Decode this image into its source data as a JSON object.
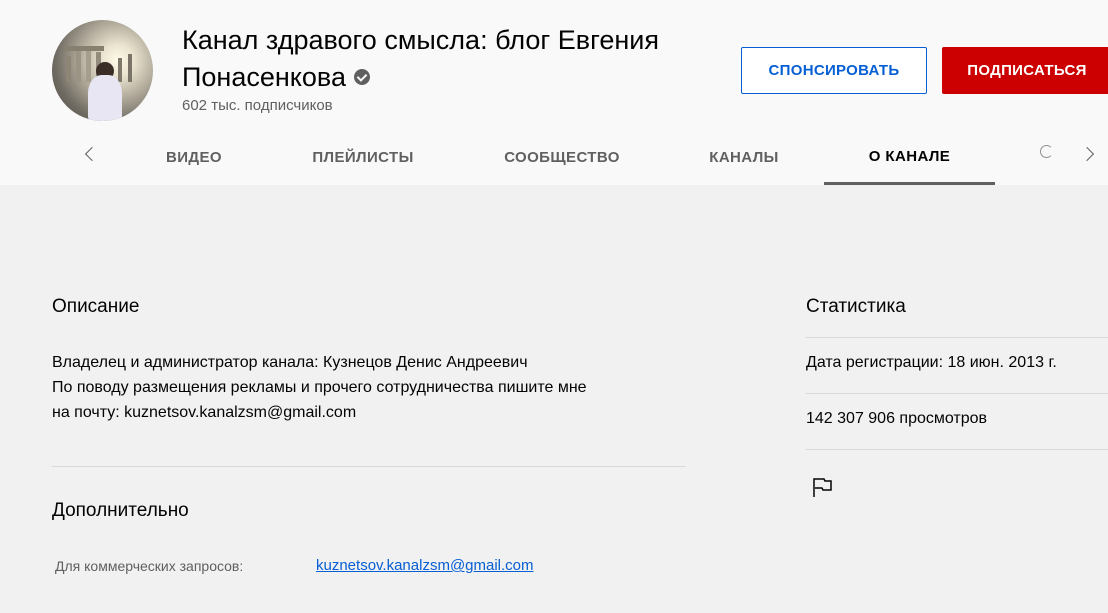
{
  "channel": {
    "title_line1": "Канал здравого смысла: блог Евгения",
    "title_line2": "Понасенкова",
    "subscribers": "602 тыс. подписчиков"
  },
  "buttons": {
    "sponsor": "СПОНСИРОВАТЬ",
    "subscribe": "ПОДПИСАТЬСЯ"
  },
  "tabs": [
    {
      "label": "ВИДЕО"
    },
    {
      "label": "ПЛЕЙЛИСТЫ"
    },
    {
      "label": "СООБЩЕСТВО"
    },
    {
      "label": "КАНАЛЫ"
    },
    {
      "label": "О КАНАЛЕ",
      "active": true
    }
  ],
  "about": {
    "description_title": "Описание",
    "description_lines": [
      "Владелец и администратор канала: Кузнецов Денис Андреевич",
      "По поводу размещения рекламы и прочего сотрудничества пишите мне",
      "на почту: kuznetsov.kanalzsm@gmail.com"
    ],
    "details_title": "Дополнительно",
    "business_label": "Для коммерческих запросов:",
    "business_email": "kuznetsov.kanalzsm@gmail.com"
  },
  "stats": {
    "title": "Статистика",
    "joined": "Дата регистрации: 18 июн. 2013 г.",
    "views": "142 307 906 просмотров"
  },
  "colors": {
    "subscribe_red": "#cc0000",
    "link_blue": "#065fd4",
    "header_bg": "#f9f9f9",
    "page_bg": "#f1f1f1"
  }
}
